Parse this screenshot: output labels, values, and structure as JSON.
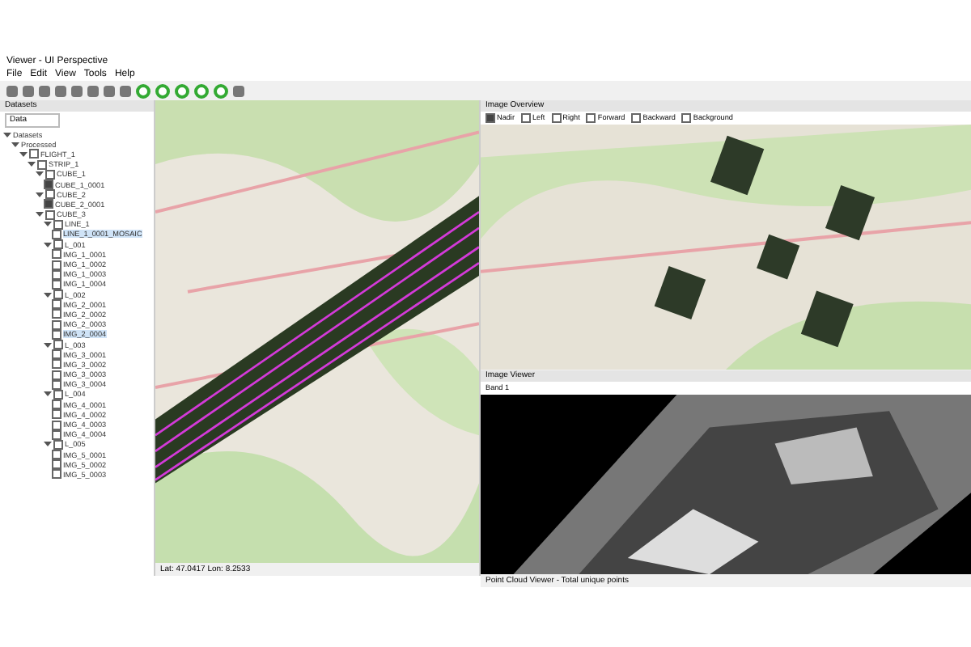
{
  "window": {
    "title": "Viewer - UI Perspective"
  },
  "menu": [
    "File",
    "Edit",
    "View",
    "Tools",
    "Help"
  ],
  "left_panel": {
    "title": "Datasets",
    "filter": "Data"
  },
  "tree": [
    {
      "label": "Datasets",
      "expanded": true,
      "children": [
        {
          "label": "Processed",
          "expanded": true,
          "children": [
            {
              "label": "FLIGHT_1",
              "expanded": true,
              "checked": false,
              "children": [
                {
                  "label": "STRIP_1",
                  "expanded": true,
                  "checked": false,
                  "children": [
                    {
                      "label": "CUBE_1",
                      "expanded": true,
                      "checked": false,
                      "children": [
                        {
                          "label": "CUBE_1_0001",
                          "checked": true
                        }
                      ]
                    },
                    {
                      "label": "CUBE_2",
                      "expanded": true,
                      "checked": false,
                      "children": [
                        {
                          "label": "CUBE_2_0001",
                          "checked": true
                        }
                      ]
                    },
                    {
                      "label": "CUBE_3",
                      "expanded": true,
                      "checked": false,
                      "children": [
                        {
                          "label": "LINE_1",
                          "expanded": true,
                          "checked": false,
                          "children": [
                            {
                              "label": "LINE_1_0001_MOSAIC",
                              "checked": false,
                              "selected": true
                            }
                          ]
                        },
                        {
                          "label": "L_001",
                          "expanded": true,
                          "checked": false,
                          "children": [
                            {
                              "label": "IMG_1_0001",
                              "checked": false
                            },
                            {
                              "label": "IMG_1_0002",
                              "checked": false
                            },
                            {
                              "label": "IMG_1_0003",
                              "checked": false
                            },
                            {
                              "label": "IMG_1_0004",
                              "checked": false
                            }
                          ]
                        },
                        {
                          "label": "L_002",
                          "expanded": true,
                          "checked": false,
                          "children": [
                            {
                              "label": "IMG_2_0001",
                              "checked": false
                            },
                            {
                              "label": "IMG_2_0002",
                              "checked": false
                            },
                            {
                              "label": "IMG_2_0003",
                              "checked": false
                            },
                            {
                              "label": "IMG_2_0004",
                              "checked": false,
                              "selected": true
                            }
                          ]
                        },
                        {
                          "label": "L_003",
                          "expanded": true,
                          "checked": false,
                          "children": [
                            {
                              "label": "IMG_3_0001",
                              "checked": false
                            },
                            {
                              "label": "IMG_3_0002",
                              "checked": false
                            },
                            {
                              "label": "IMG_3_0003",
                              "checked": false
                            },
                            {
                              "label": "IMG_3_0004",
                              "checked": false
                            }
                          ]
                        },
                        {
                          "label": "L_004",
                          "expanded": true,
                          "checked": false,
                          "children": [
                            {
                              "label": "IMG_4_0001",
                              "checked": false
                            },
                            {
                              "label": "IMG_4_0002",
                              "checked": false
                            },
                            {
                              "label": "IMG_4_0003",
                              "checked": false
                            },
                            {
                              "label": "IMG_4_0004",
                              "checked": false
                            }
                          ]
                        },
                        {
                          "label": "L_005",
                          "expanded": true,
                          "checked": false,
                          "children": [
                            {
                              "label": "IMG_5_0001",
                              "checked": false
                            },
                            {
                              "label": "IMG_5_0002",
                              "checked": false
                            },
                            {
                              "label": "IMG_5_0003",
                              "checked": false
                            }
                          ]
                        }
                      ]
                    }
                  ]
                }
              ]
            }
          ]
        }
      ]
    }
  ],
  "map_status": "Lat: 47.0417 Lon: 8.2533",
  "right_top": {
    "title": "Image Overview",
    "toolbar": [
      {
        "label": "Nadir",
        "checked": true
      },
      {
        "label": "Left",
        "checked": false
      },
      {
        "label": "Right",
        "checked": false
      },
      {
        "label": "Forward",
        "checked": false
      },
      {
        "label": "Backward",
        "checked": false
      },
      {
        "label": "Background",
        "checked": false
      }
    ]
  },
  "right_bottom": {
    "title": "Image Viewer",
    "band": "Band 1"
  },
  "image_status": "Point Cloud Viewer - Total unique points"
}
